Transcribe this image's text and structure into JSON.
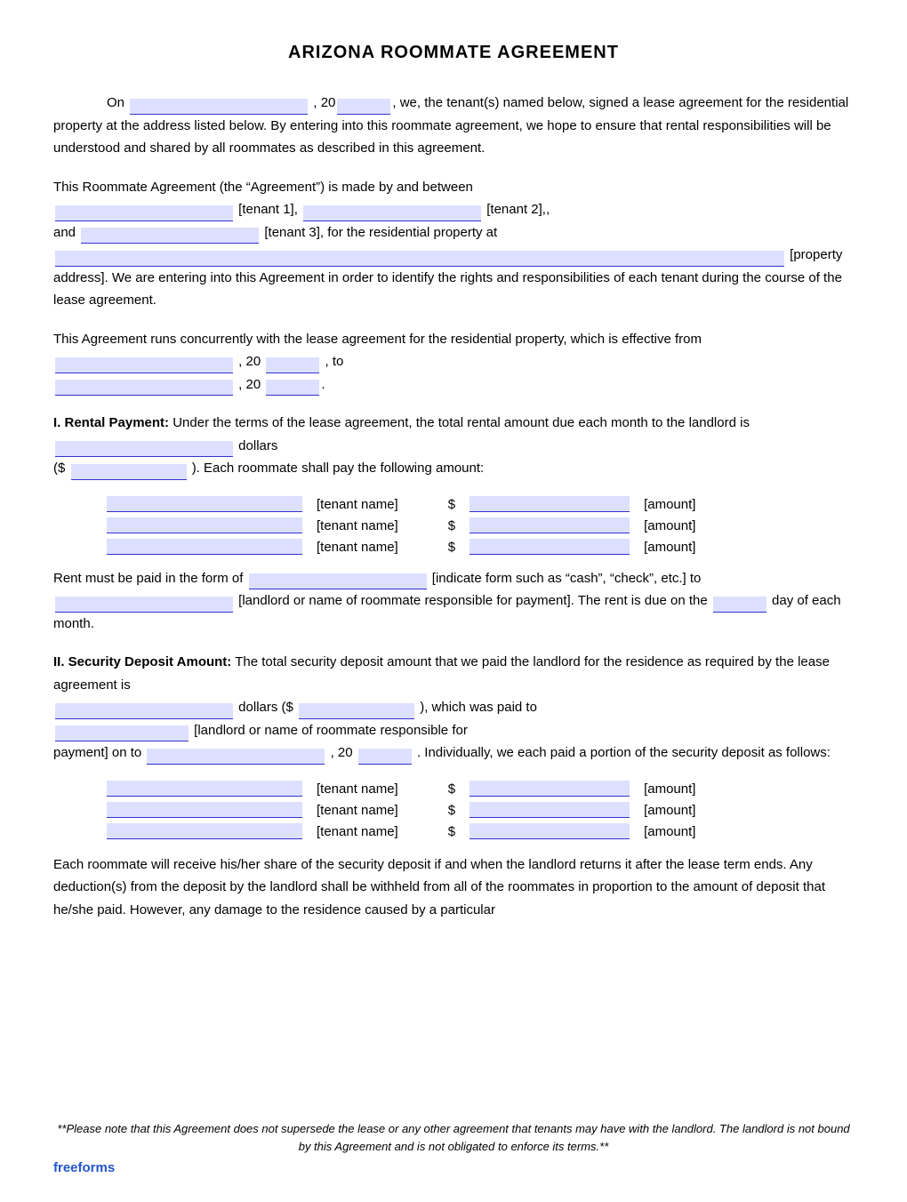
{
  "title": "ARIZONA ROOMMATE AGREEMENT",
  "paragraphs": {
    "intro": "On",
    "intro_year": ", 20",
    "intro_rest": ", we, the tenant(s) named below, signed a lease agreement for the residential property at the address listed below. By entering into this roommate agreement, we hope to ensure that rental responsibilities will be understood and shared by all roommates as described in this agreement.",
    "agreement_intro": "This Roommate Agreement (the “Agreement”) is made by and between",
    "tenant1_label": "[tenant 1],",
    "tenant2_label": "[tenant 2],,",
    "and_label": "and",
    "tenant3_label": "[tenant 3], for the residential property at",
    "property_label": "[property address]. We are entering into this Agreement in order to identify the rights and responsibilities of each tenant during the course of the lease agreement.",
    "concurrent": "This Agreement runs concurrently with the lease agreement for the residential property, which is effective from",
    "concurrent_year1": ", 20",
    "concurrent_to": ", to",
    "concurrent_year2": ", 20",
    "rental_header": "I.  Rental Payment:",
    "rental_text": " Under the terms of the lease agreement, the total rental amount due each month to the landlord is",
    "rental_dollars": "dollars",
    "rental_amount_prefix": "($",
    "rental_amount_suffix": ").  Each roommate shall pay the following amount:",
    "tenant_name_label": "[tenant name]",
    "amount_label": "[amount]",
    "rent_form_text1": "Rent must be paid in the form of",
    "rent_form_indicate": "[indicate form such as “cash”, “check”, etc.] to",
    "rent_form_landlord": "[landlord or name of roommate responsible for payment]. The rent is due on the",
    "rent_due_day": "____",
    "rent_due_suffix": "day of each month.",
    "security_header": "II.  Security Deposit Amount:",
    "security_text1": " The total security deposit amount that we paid the landlord for the residence as required by the lease agreement is",
    "security_dollars_label": "dollars ($",
    "security_paid_to": "), which was paid to",
    "security_landlord_label": "[landlord or name of roommate responsible for",
    "security_payment_label": "payment] on to",
    "security_year": ", 20",
    "security_individually": ". Individually, we each paid a portion of the security deposit as follows:",
    "each_roommate_text": "Each roommate will receive his/her share of the security deposit if and when the landlord returns it after the lease term ends. Any deduction(s) from the deposit by the landlord shall be withheld from all of the roommates in proportion to the amount of deposit that he/she paid. However, any damage to the residence caused by a particular",
    "footer_note": "**Please note that this Agreement does not supersede the lease or any other agreement that tenants may have with the landlord. The landlord is not bound by this Agreement and is not obligated to enforce its terms.**",
    "freeforms_label": "freeforms"
  }
}
